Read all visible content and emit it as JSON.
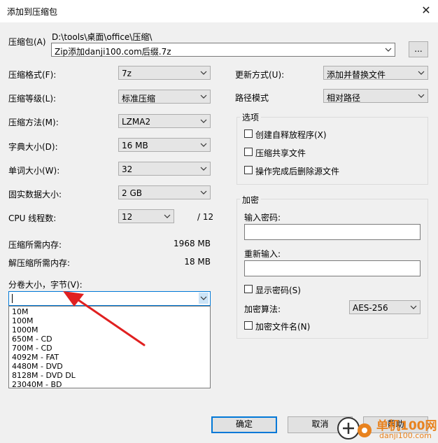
{
  "window": {
    "title": "添加到压缩包",
    "close_glyph": "✕"
  },
  "archive": {
    "label": "压缩包(A)",
    "path": "D:\\tools\\桌面\\office\\压缩\\",
    "filename": "Zip添加danji100.com后缀.7z",
    "browse_label": "..."
  },
  "left": {
    "format": {
      "label": "压缩格式(F):",
      "value": "7z"
    },
    "level": {
      "label": "压缩等级(L):",
      "value": "标准压缩"
    },
    "method": {
      "label": "压缩方法(M):",
      "value": "LZMA2"
    },
    "dict": {
      "label": "字典大小(D):",
      "value": "16 MB"
    },
    "word": {
      "label": "单词大小(W):",
      "value": "32"
    },
    "solid": {
      "label": "固实数据大小:",
      "value": "2 GB"
    },
    "cpu": {
      "label": "CPU 线程数:",
      "value": "12",
      "total": "/ 12"
    },
    "mem_compress": {
      "label": "压缩所需内存:",
      "value": "1968 MB"
    },
    "mem_decompress": {
      "label": "解压缩所需内存:",
      "value": "18 MB"
    },
    "split": {
      "label": "分卷大小，字节(V):",
      "value": "",
      "options": [
        "10M",
        "100M",
        "1000M",
        "650M - CD",
        "700M - CD",
        "4092M - FAT",
        "4480M - DVD",
        "8128M - DVD DL",
        "23040M - BD"
      ]
    }
  },
  "right": {
    "update": {
      "label": "更新方式(U):",
      "value": "添加并替换文件"
    },
    "pathmode": {
      "label": "路径模式",
      "value": "相对路径"
    },
    "options": {
      "title": "选项",
      "sfx": "创建自释放程序(X)",
      "shared": "压缩共享文件",
      "delete": "操作完成后删除源文件"
    },
    "encrypt": {
      "title": "加密",
      "password_label": "输入密码:",
      "reenter_label": "重新输入:",
      "show_password": "显示密码(S)",
      "method_label": "加密算法:",
      "method_value": "AES-256",
      "encrypt_names": "加密文件名(N)"
    }
  },
  "buttons": {
    "ok": "确定",
    "cancel": "取消",
    "help": "帮助"
  },
  "watermark": {
    "text": "单机100网",
    "url": "danji100.com"
  },
  "colors": {
    "accent": "#0078d7",
    "arrow": "#e02020",
    "watermark": "#e8821e"
  }
}
